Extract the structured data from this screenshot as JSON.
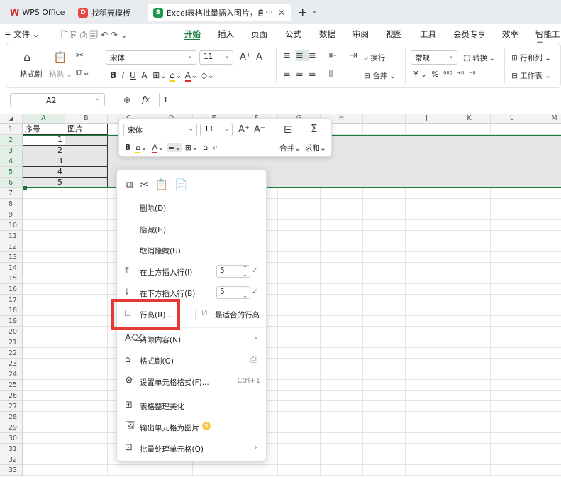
{
  "titlebar": {
    "wps_tab": "WPS Office",
    "template_tab": "找稻壳模板",
    "doc_tab": "Excel表格批量插入图片，自动",
    "new_tab": "+",
    "dropdown": "⌄"
  },
  "menubar": {
    "file": "≡ 文件",
    "items": [
      "开始",
      "插入",
      "页面",
      "公式",
      "数据",
      "审阅",
      "视图",
      "工具",
      "会员专享",
      "效率",
      "智能工具"
    ]
  },
  "ribbon": {
    "format_painter": "格式刷",
    "paste": "粘贴",
    "font_name": "宋体",
    "font_size": "11",
    "wrap": "换行",
    "number_format": "常规",
    "convert": "转换",
    "row_col": "行和列",
    "merge": "合并",
    "worksheet": "工作表"
  },
  "formula": {
    "cell_ref": "A2",
    "value": "1",
    "fx": "fx"
  },
  "grid": {
    "columns": [
      "A",
      "B",
      "C",
      "D",
      "E",
      "F",
      "G",
      "H",
      "I",
      "J",
      "K",
      "L",
      "M"
    ],
    "rows": [
      "1",
      "2",
      "3",
      "4",
      "5",
      "6",
      "7",
      "8",
      "9",
      "10",
      "11",
      "12",
      "13",
      "14",
      "15",
      "16",
      "17",
      "18",
      "19",
      "20",
      "21",
      "22",
      "23",
      "24",
      "25",
      "26",
      "27",
      "28",
      "29",
      "30",
      "31",
      "32",
      "33"
    ],
    "header_a": "序号",
    "header_b": "图片",
    "values": [
      "1",
      "2",
      "3",
      "4",
      "5"
    ]
  },
  "mini_toolbar": {
    "font_name": "宋体",
    "font_size": "11",
    "merge": "合并",
    "sum": "求和"
  },
  "context_menu": {
    "delete": "删除(D)",
    "hide": "隐藏(H)",
    "unhide": "取消隐藏(U)",
    "insert_above": "在上方插入行(I)",
    "insert_above_count": "5",
    "insert_below": "在下方插入行(B)",
    "insert_below_count": "5",
    "row_height": "行高(R)...",
    "best_fit": "最适合的行高",
    "clear": "清除内容(N)",
    "format_painter": "格式刷(O)",
    "cell_format": "设置单元格格式(F)...",
    "cell_format_shortcut": "Ctrl+1",
    "beautify": "表格整理美化",
    "export_image": "输出单元格为图片",
    "batch": "批量处理单元格(Q)"
  },
  "colors": {
    "accent_green": "#1a7a3c",
    "highlight_red": "#e53935",
    "wps_red": "#d9302b"
  }
}
